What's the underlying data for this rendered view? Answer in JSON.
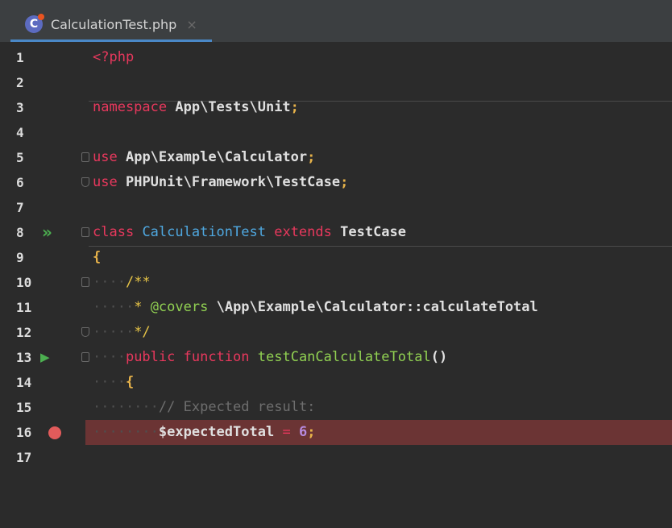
{
  "tab": {
    "filename": "CalculationTest.php",
    "close": "×",
    "icon": "php-file-icon"
  },
  "colors": {
    "keyword": "#e8385d",
    "class_name": "#4fa8e0",
    "function_name": "#91d152",
    "docblock": "#e6c447",
    "comment": "#6e6e6e",
    "number": "#b78be0",
    "breakpoint_line": "#6b3434",
    "run_icon": "#4caf50"
  },
  "lines": [
    {
      "num": "1",
      "tokens": [
        {
          "t": "<?php",
          "c": "kw"
        }
      ]
    },
    {
      "num": "2",
      "tokens": []
    },
    {
      "num": "3",
      "tokens": [
        {
          "t": "namespace",
          "c": "kw"
        },
        {
          "t": " ",
          "c": "ws"
        },
        {
          "t": "App\\Tests\\Unit",
          "c": "id"
        },
        {
          "t": ";",
          "c": "punct"
        }
      ]
    },
    {
      "num": "4",
      "tokens": []
    },
    {
      "num": "5",
      "fold": "start",
      "tokens": [
        {
          "t": "use",
          "c": "kw"
        },
        {
          "t": " ",
          "c": "ws"
        },
        {
          "t": "App\\Example\\Calculator",
          "c": "id"
        },
        {
          "t": ";",
          "c": "punct"
        }
      ]
    },
    {
      "num": "6",
      "fold": "end",
      "tokens": [
        {
          "t": "use",
          "c": "kw"
        },
        {
          "t": " ",
          "c": "ws"
        },
        {
          "t": "PHPUnit\\Framework\\TestCase",
          "c": "id"
        },
        {
          "t": ";",
          "c": "punct"
        }
      ]
    },
    {
      "num": "7",
      "tokens": []
    },
    {
      "num": "8",
      "run": "»",
      "fold": "start",
      "tokens": [
        {
          "t": "class",
          "c": "kw"
        },
        {
          "t": " ",
          "c": "ws"
        },
        {
          "t": "CalculationTest",
          "c": "cls"
        },
        {
          "t": " ",
          "c": "ws"
        },
        {
          "t": "extends",
          "c": "kw"
        },
        {
          "t": " ",
          "c": "ws"
        },
        {
          "t": "TestCase",
          "c": "id"
        }
      ]
    },
    {
      "num": "9",
      "tokens": [
        {
          "t": "{",
          "c": "punct"
        }
      ]
    },
    {
      "num": "10",
      "fold": "start",
      "tokens": [
        {
          "t": "····",
          "c": "ws"
        },
        {
          "t": "/**",
          "c": "doc"
        }
      ]
    },
    {
      "num": "11",
      "tokens": [
        {
          "t": "·····",
          "c": "ws"
        },
        {
          "t": "*",
          "c": "doc"
        },
        {
          "t": " ",
          "c": "ws"
        },
        {
          "t": "@covers",
          "c": "tag"
        },
        {
          "t": " ",
          "c": "ws"
        },
        {
          "t": "\\App\\Example\\Calculator::calculateTotal",
          "c": "id"
        }
      ]
    },
    {
      "num": "12",
      "fold": "end",
      "tokens": [
        {
          "t": "·····",
          "c": "ws"
        },
        {
          "t": "*/",
          "c": "doc"
        }
      ]
    },
    {
      "num": "13",
      "run": "▶",
      "fold": "start",
      "tokens": [
        {
          "t": "····",
          "c": "ws"
        },
        {
          "t": "public",
          "c": "kw"
        },
        {
          "t": " ",
          "c": "ws"
        },
        {
          "t": "function",
          "c": "kw"
        },
        {
          "t": " ",
          "c": "ws"
        },
        {
          "t": "testCanCalculateTotal",
          "c": "fn"
        },
        {
          "t": "()",
          "c": "id"
        }
      ]
    },
    {
      "num": "14",
      "tokens": [
        {
          "t": "····",
          "c": "ws"
        },
        {
          "t": "{",
          "c": "punct"
        }
      ]
    },
    {
      "num": "15",
      "tokens": [
        {
          "t": "········",
          "c": "ws"
        },
        {
          "t": "//",
          "c": "cmt"
        },
        {
          "t": " ",
          "c": "ws"
        },
        {
          "t": "Expected",
          "c": "cmt"
        },
        {
          "t": " ",
          "c": "ws"
        },
        {
          "t": "result:",
          "c": "cmt"
        }
      ]
    },
    {
      "num": "16",
      "breakpoint": true,
      "tokens": [
        {
          "t": "········",
          "c": "ws"
        },
        {
          "t": "$expectedTotal",
          "c": "id"
        },
        {
          "t": " ",
          "c": "ws"
        },
        {
          "t": "=",
          "c": "kw"
        },
        {
          "t": " ",
          "c": "ws"
        },
        {
          "t": "6",
          "c": "num"
        },
        {
          "t": ";",
          "c": "punct"
        }
      ]
    },
    {
      "num": "17",
      "tokens": []
    }
  ]
}
